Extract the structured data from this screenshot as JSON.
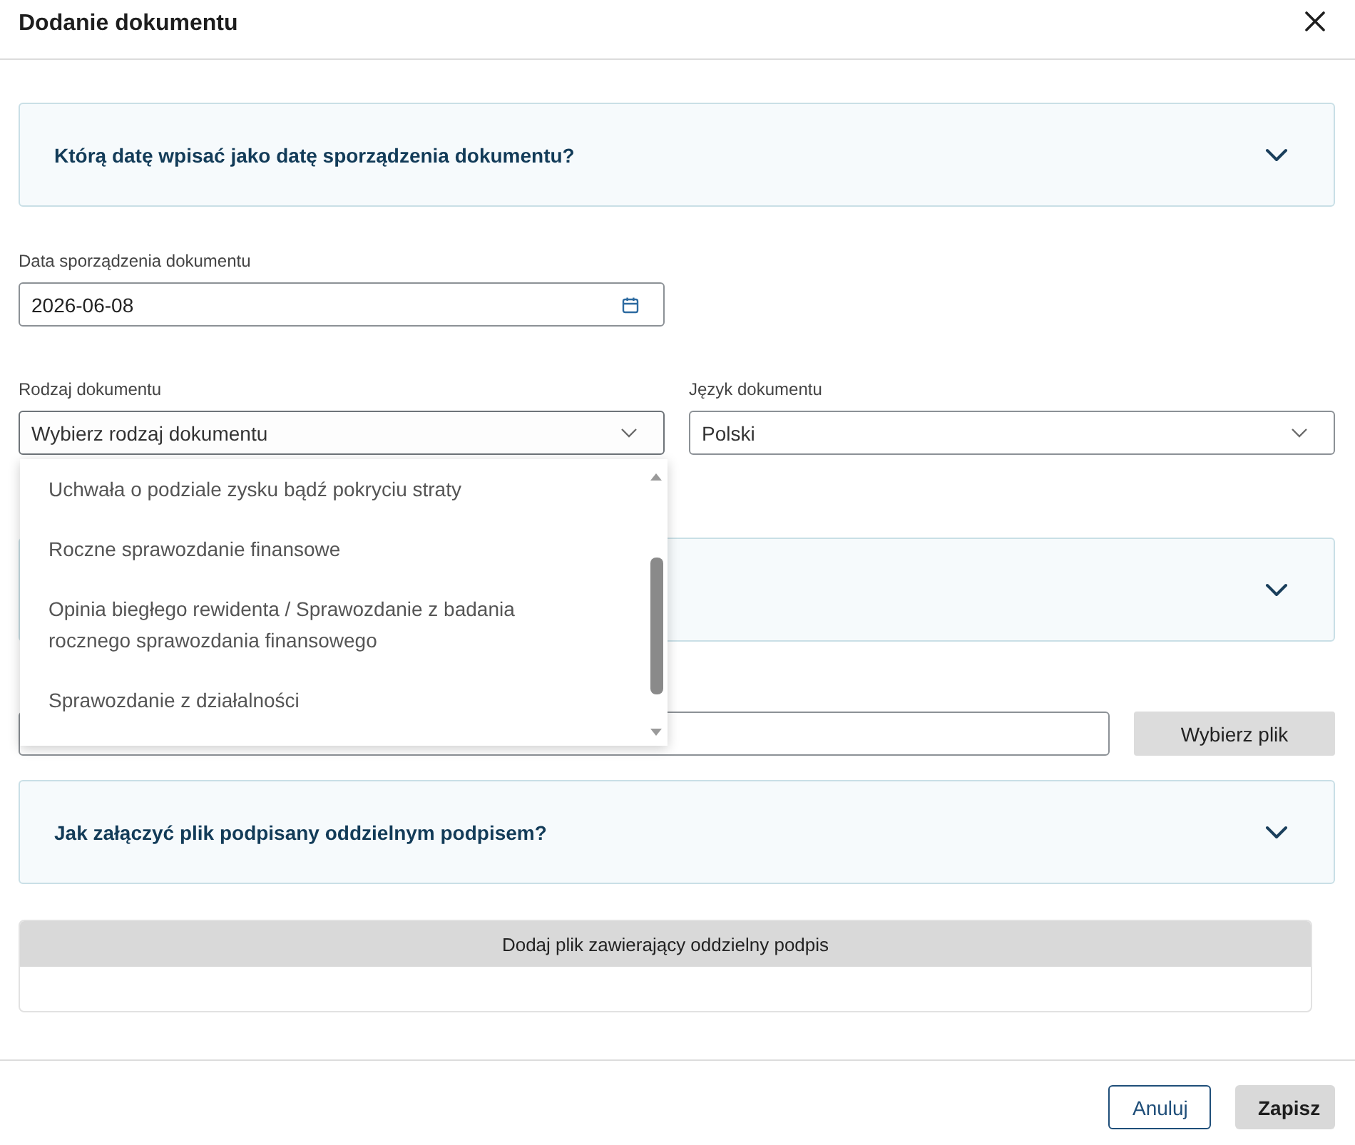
{
  "dialog": {
    "title": "Dodanie dokumentu"
  },
  "help_1": {
    "title": "Którą datę wpisać jako datę sporządzenia dokumentu?",
    "expanded": false
  },
  "date_field": {
    "label": "Data sporządzenia dokumentu",
    "value": "2026-06-08"
  },
  "document_type": {
    "label": "Rodzaj dokumentu",
    "placeholder": "Wybierz rodzaj dokumentu",
    "expanded": true,
    "options": [
      {
        "label": "Uchwała o podziale zysku bądź pokryciu straty",
        "selected": false
      },
      {
        "label": "Roczne sprawozdanie finansowe",
        "selected": false
      },
      {
        "label": "Opinia biegłego rewidenta / Sprawozdanie z badania rocznego sprawozdania finansowego",
        "selected": false
      },
      {
        "label": "Sprawozdanie z działalności",
        "selected": false
      }
    ]
  },
  "language": {
    "label": "Język dokumentu",
    "value": "Polski"
  },
  "help_2": {
    "expanded": false
  },
  "file": {
    "button": "Wybierz plik"
  },
  "help_3": {
    "title": "Jak załączyć plik podpisany oddzielnym podpisem?",
    "expanded": false
  },
  "signature": {
    "button": "Dodaj plik zawierający oddzielny podpis"
  },
  "footer": {
    "buttons": [
      {
        "label": "Anuluj",
        "kind": "secondary"
      },
      {
        "label": "Zapisz",
        "kind": "primary"
      }
    ]
  }
}
